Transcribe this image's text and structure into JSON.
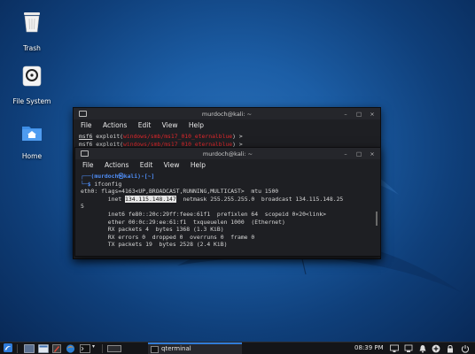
{
  "desktop": {
    "icons": [
      {
        "label": "Trash"
      },
      {
        "label": "File System"
      },
      {
        "label": "Home"
      }
    ]
  },
  "terminal_back": {
    "title": "murdoch@kali: ~",
    "menu": [
      "File",
      "Actions",
      "Edit",
      "View",
      "Help"
    ],
    "lines": [
      {
        "prompt": "msf6",
        "cmd": "exploit(",
        "module": "windows/smb/ms17_010_eternalblue",
        "end": ") >"
      },
      {
        "prompt": "msf6",
        "cmd": "exploit(",
        "module": "windows/smb/ms17_010_eternalblue",
        "end": ") >"
      }
    ]
  },
  "terminal_front": {
    "title": "murdoch@kali: ~",
    "menu": [
      "File",
      "Actions",
      "Edit",
      "View",
      "Help"
    ],
    "prompt_user": "(murdoch㉿kali)-[~]",
    "prompt_sym": "$",
    "command": "ifconfig",
    "output": {
      "l1": "eth0: flags=4163<UP,BROADCAST,RUNNING,MULTICAST>  mtu 1500",
      "inet_label": "        inet ",
      "inet_ip": "134.115.148.147",
      "inet_rest": "  netmask 255.255.255.0  broadcast 134.115.148.25",
      "l3": "5",
      "l4": "        inet6 fe80::20c:29ff:feee:61f1  prefixlen 64  scopeid 0×20<link>",
      "l5": "        ether 00:0c:29:ee:61:f1  txqueuelen 1000  (Ethernet)",
      "l6": "        RX packets 4  bytes 1368 (1.3 KiB)",
      "l7": "        RX errors 0  dropped 0  overruns 0  frame 0",
      "l8": "        TX packets 19  bytes 2528 (2.4 KiB)"
    }
  },
  "taskbar": {
    "active_task": "qterminal",
    "clock": "08:39 PM",
    "colors": {
      "kali_blue": "#2f7bd9",
      "folder_blue": "#3d8ee6"
    }
  }
}
